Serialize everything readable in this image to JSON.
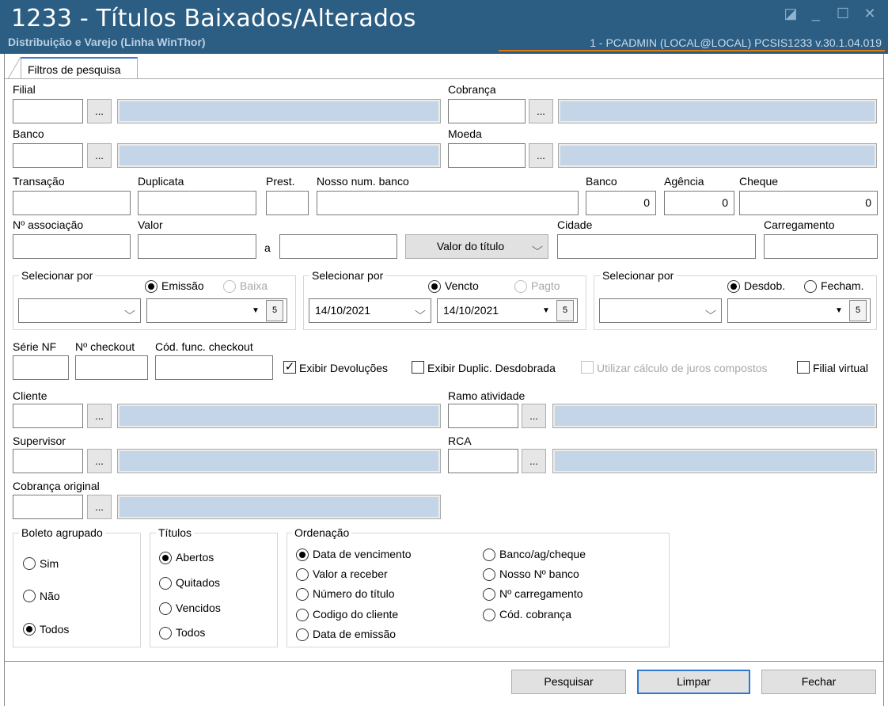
{
  "window": {
    "title": "1233 - Títulos Baixados/Alterados",
    "subtitle": "Distribuição e Varejo (Linha WinThor)",
    "user_info": "1 - PCADMIN (LOCAL@LOCAL)   PCSIS1233  v.30.1.04.019",
    "controls": {
      "restore": "◪",
      "minimize": "_",
      "maximize": "☐",
      "close": "✕"
    }
  },
  "tab": {
    "label": "Filtros de pesquisa"
  },
  "dots": "...",
  "labels": {
    "filial": "Filial",
    "cobranca": "Cobrança",
    "banco": "Banco",
    "moeda": "Moeda",
    "transacao": "Transação",
    "duplicata": "Duplicata",
    "prest": "Prest.",
    "nosso_num": "Nosso num. banco",
    "banco2": "Banco",
    "agencia": "Agência",
    "cheque": "Cheque",
    "num_associacao": "Nº associação",
    "valor": "Valor",
    "a": "a",
    "cidade": "Cidade",
    "carregamento": "Carregamento",
    "serie_nf": "Série NF",
    "num_checkout": "Nº checkout",
    "cod_func_checkout": "Cód. func. checkout",
    "cliente": "Cliente",
    "ramo": "Ramo atividade",
    "supervisor": "Supervisor",
    "rca": "RCA",
    "cobranca_original": "Cobrança original"
  },
  "values": {
    "banco": "0",
    "agencia": "0",
    "cheque": "0"
  },
  "valor_select": "Valor do título",
  "selecionar": [
    {
      "title": "Selecionar por",
      "opt1": "Emissão",
      "opt2": "Baixa",
      "date1": "",
      "date2": ""
    },
    {
      "title": "Selecionar por",
      "opt1": "Vencto",
      "opt2": "Pagto",
      "date1": "14/10/2021",
      "date2": "14/10/2021"
    },
    {
      "title": "Selecionar por",
      "opt1": "Desdob.",
      "opt2": "Fecham.",
      "date1": "",
      "date2": ""
    }
  ],
  "checks": {
    "exibir_devolucoes": "Exibir Devoluções",
    "exibir_duplic": "Exibir Duplic. Desdobrada",
    "juros": "Utilizar cálculo de juros compostos",
    "filial_virtual": "Filial virtual",
    "check_mark": "✓"
  },
  "boleto": {
    "title": "Boleto agrupado",
    "options": [
      "Sim",
      "Não",
      "Todos"
    ]
  },
  "titulos": {
    "title": "Títulos",
    "options": [
      "Abertos",
      "Quitados",
      "Vencidos",
      "Todos"
    ]
  },
  "ordenacao": {
    "title": "Ordenação",
    "left": [
      "Data de vencimento",
      "Valor a receber",
      "Número do título",
      "Codigo do cliente",
      "Data de emissão"
    ],
    "right": [
      "Banco/ag/cheque",
      "Nosso Nº banco",
      "Nº carregamento",
      "Cód. cobrança"
    ]
  },
  "buttons": {
    "pesquisar": "Pesquisar",
    "limpar": "Limpar",
    "fechar": "Fechar"
  },
  "icons": {
    "chevron": "⌵",
    "dropdown": "▼",
    "calendar": "5"
  },
  "colors": {
    "titlebar": "#2c5d82",
    "readonly_field": "#c3d5e6",
    "accent": "#e07a10"
  }
}
